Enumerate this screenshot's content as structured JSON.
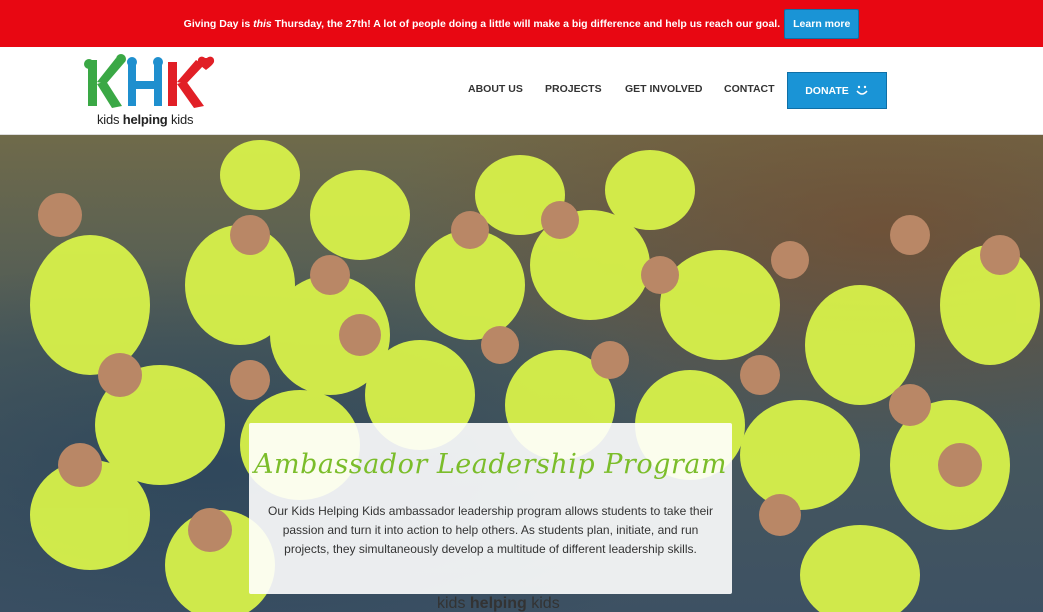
{
  "banner": {
    "prefix": "Giving Day is ",
    "emphasis": "this",
    "suffix": " Thursday, the 27th! A lot of people doing a little will make a big difference and help us reach our goal.",
    "button_label": "Learn more",
    "color": "#e80712"
  },
  "logo": {
    "letters": "KHK",
    "tagline_kids1": "kids ",
    "tagline_helping": "helping",
    "tagline_kids2": " kids"
  },
  "nav": {
    "items": [
      {
        "label": "ABOUT US"
      },
      {
        "label": "PROJECTS"
      },
      {
        "label": "GET INVOLVED"
      },
      {
        "label": "CONTACT"
      }
    ],
    "donate_label": "DONATE",
    "accent": "#1a94d6"
  },
  "hero": {
    "title": "Ambassador Leadership Program",
    "body": "Our Kids Helping Kids ambassador leadership program allows students to take their passion and turn it into action to help others. As students plan, initiate, and run projects, they simultaneously develop a multitude of different leadership skills.",
    "shirt_color": "#d8f24a",
    "bottom_logo_kids1": "kids ",
    "bottom_logo_helping": "helping",
    "bottom_logo_kids2": " kids"
  }
}
